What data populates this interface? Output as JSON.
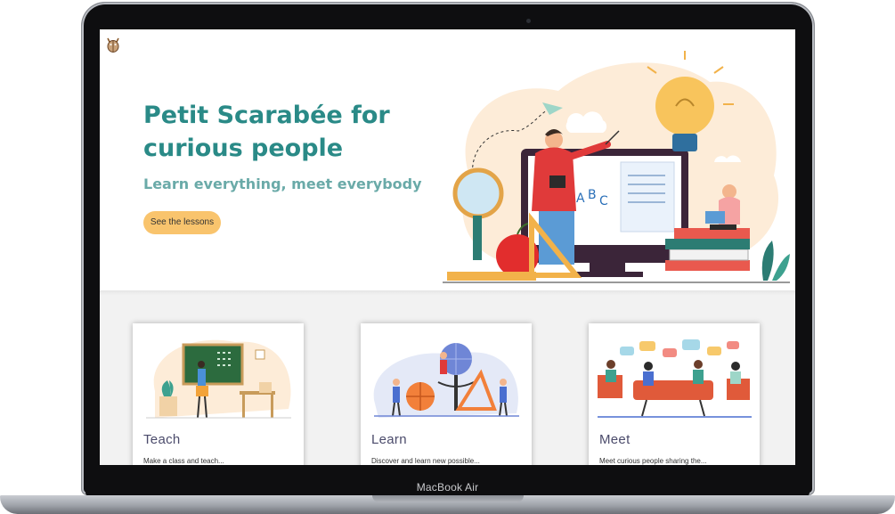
{
  "device": {
    "model_label": "MacBook Air"
  },
  "hero": {
    "title": "Petit Scarabée for curious people",
    "subtitle": "Learn everything, meet everybody",
    "cta_label": "See the lessons"
  },
  "cards": [
    {
      "title": "Teach",
      "text": "Make a class and teach..."
    },
    {
      "title": "Learn",
      "text": "Discover and learn new possible..."
    },
    {
      "title": "Meet",
      "text": "Meet curious people sharing the..."
    }
  ],
  "colors": {
    "brand_teal": "#2a8a87",
    "subtitle_teal": "#6aaaa8",
    "cta_orange": "#f9c46d",
    "card_title": "#4b4b6b",
    "section_bg": "#f2f2f2"
  }
}
